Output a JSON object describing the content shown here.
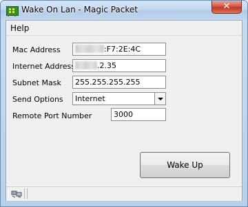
{
  "window": {
    "title": "Wake On Lan - Magic Packet",
    "close_label": "✕"
  },
  "menu": {
    "items": [
      "Help"
    ]
  },
  "form": {
    "mac_address": {
      "label": "Mac Address",
      "value": ":F7:2E:4C"
    },
    "internet_address": {
      "label": "Internet Address",
      "value": ".2.35"
    },
    "subnet_mask": {
      "label": "Subnet Mask",
      "value": "255.255.255.255"
    },
    "send_options": {
      "label": "Send Options",
      "value": "Internet"
    },
    "remote_port": {
      "label": "Remote Port Number",
      "value": "3000"
    }
  },
  "actions": {
    "wake_up_label": "Wake Up"
  },
  "icons": {
    "app": "network-card-icon",
    "status": "network-status-icon"
  }
}
